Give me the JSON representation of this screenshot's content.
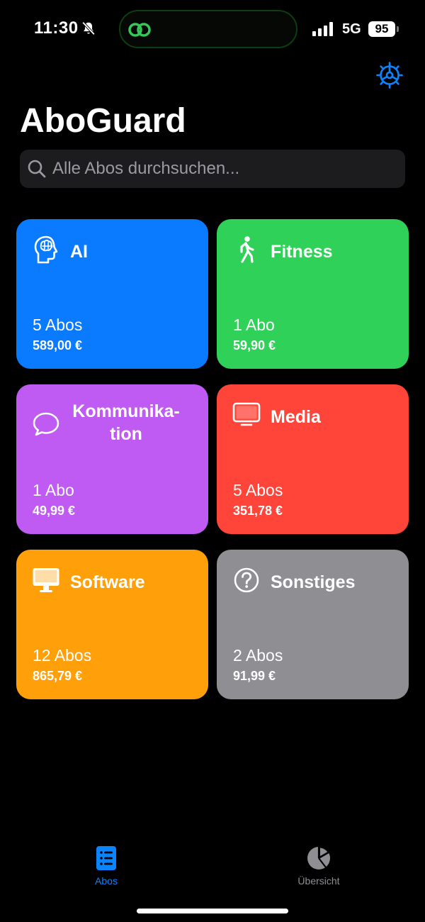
{
  "status": {
    "time": "11:30",
    "network": "5G",
    "battery": "95"
  },
  "header": {
    "title": "AboGuard"
  },
  "search": {
    "placeholder": "Alle Abos durchsuchen..."
  },
  "categories": [
    {
      "name": "AI",
      "count": "5 Abos",
      "sum": "589,00 €",
      "color": "#0a7aff",
      "icon": "brain-head-icon"
    },
    {
      "name": "Fitness",
      "count": "1 Abo",
      "sum": "59,90 €",
      "color": "#30d158",
      "icon": "walking-person-icon"
    },
    {
      "name": "Kommunika-\ntion",
      "count": "1 Abo",
      "sum": "49,99 €",
      "color": "#bf5af2",
      "icon": "speech-bubble-icon"
    },
    {
      "name": "Media",
      "count": "5 Abos",
      "sum": "351,78 €",
      "color": "#ff453a",
      "icon": "tv-icon"
    },
    {
      "name": "Software",
      "count": "12 Abos",
      "sum": "865,79 €",
      "color": "#ff9f0a",
      "icon": "desktop-icon"
    },
    {
      "name": "Sonstiges",
      "count": "2 Abos",
      "sum": "91,99 €",
      "color": "#8e8e93",
      "icon": "question-circle-icon"
    }
  ],
  "tabs": [
    {
      "label": "Abos",
      "active": true,
      "icon": "list-icon"
    },
    {
      "label": "Übersicht",
      "active": false,
      "icon": "pie-chart-icon"
    }
  ],
  "colors": {
    "accent": "#0a84ff",
    "inactive": "#8e8e93"
  }
}
